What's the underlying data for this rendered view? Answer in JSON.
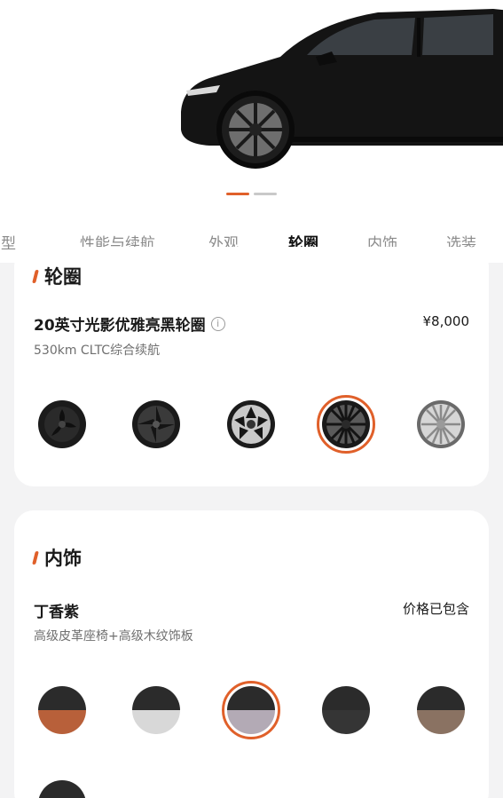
{
  "tabs": [
    {
      "label": "车型"
    },
    {
      "label": "性能与续航"
    },
    {
      "label": "外观"
    },
    {
      "label": "轮圈"
    },
    {
      "label": "内饰"
    },
    {
      "label": "选装"
    }
  ],
  "active_tab": "轮圈",
  "carousel": {
    "count": 2,
    "active_index": 0
  },
  "wheels_section": {
    "title": "轮圈",
    "selected_name": "20英寸光影优雅亮黑轮圈",
    "info_icon": "i",
    "price": "¥8,000",
    "subtitle": "530km CLTC综合续航",
    "options": [
      {
        "id": "wheel-1",
        "style": "black-aero"
      },
      {
        "id": "wheel-2",
        "style": "black-twist"
      },
      {
        "id": "wheel-3",
        "style": "machined-spoke"
      },
      {
        "id": "wheel-4",
        "style": "gloss-black-multispoke",
        "selected": true
      },
      {
        "id": "wheel-5",
        "style": "silver-multispoke"
      }
    ]
  },
  "interior_section": {
    "title": "内饰",
    "selected_name": "丁香紫",
    "price": "价格已包含",
    "subtitle": "高级皮革座椅+高级木纹饰板",
    "options": [
      {
        "id": "interior-1",
        "bottom_color": "#b8603a"
      },
      {
        "id": "interior-2",
        "bottom_color": "#d8d8d8"
      },
      {
        "id": "interior-3",
        "bottom_color": "#b3aab5",
        "selected": true
      },
      {
        "id": "interior-4",
        "bottom_color": "#353535"
      },
      {
        "id": "interior-5",
        "bottom_color": "#8a7262"
      },
      {
        "id": "interior-6",
        "bottom_color": "#2b2b2b"
      }
    ]
  },
  "colors": {
    "accent": "#e0602a",
    "car_body": "#141414"
  }
}
